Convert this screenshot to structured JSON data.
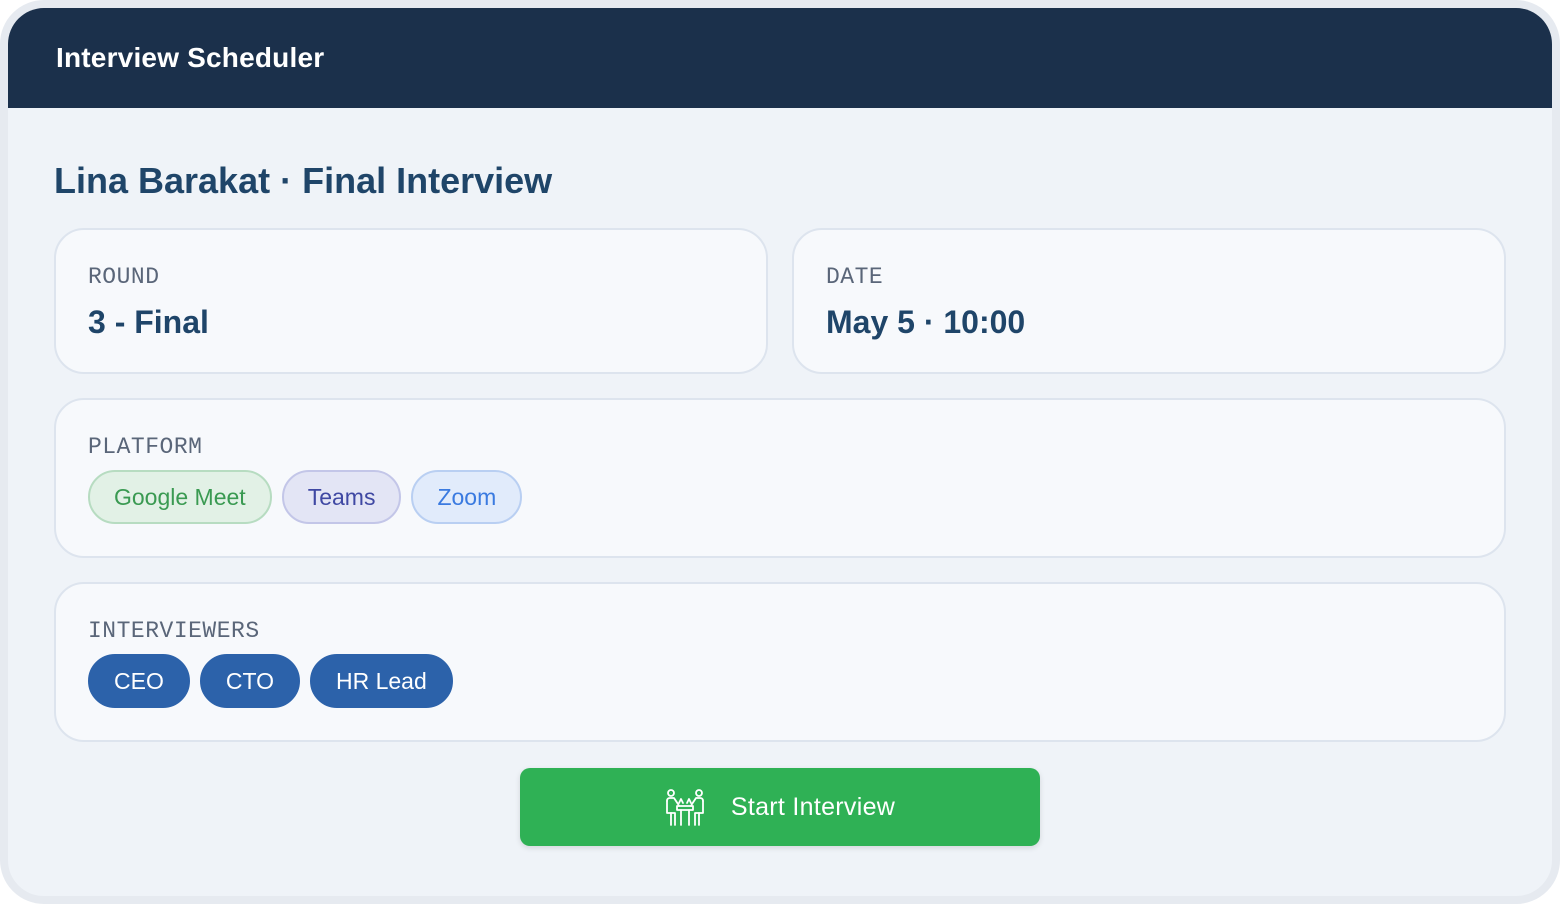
{
  "app": {
    "title": "Interview Scheduler"
  },
  "page": {
    "title": "Lina Barakat · Final Interview"
  },
  "round": {
    "label": "ROUND",
    "value": "3 - Final"
  },
  "date": {
    "label": "DATE",
    "value": "May 5 · 10:00"
  },
  "platform": {
    "label": "PLATFORM",
    "options": [
      "Google Meet",
      "Teams",
      "Zoom"
    ]
  },
  "interviewers": {
    "label": "INTERVIEWERS",
    "items": [
      "CEO",
      "CTO",
      "HR Lead"
    ]
  },
  "actions": {
    "start_label": "Start Interview",
    "start_icon": "interview-meeting-icon"
  },
  "colors": {
    "header_bg": "#1b304b",
    "title_text": "#1f4569",
    "primary_pill": "#2c62aa",
    "start_button": "#2fb155",
    "google_meet_text": "#3a9a52",
    "teams_text": "#3f48a3",
    "zoom_text": "#3a7ae0"
  }
}
